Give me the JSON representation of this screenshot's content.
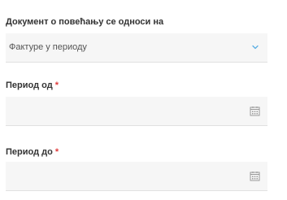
{
  "document_relation": {
    "label": "Документ о повећању се односи на",
    "selected_value": "Фактуре у периоду",
    "icon": "chevron-down-icon"
  },
  "period_from": {
    "label": "Период од",
    "required_marker": "*",
    "value": "",
    "icon": "calendar-icon"
  },
  "period_to": {
    "label": "Период до",
    "required_marker": "*",
    "value": "",
    "icon": "calendar-icon"
  },
  "colors": {
    "field_background": "#f6f6f6",
    "required": "#e03c3c",
    "chevron": "#5aaee3",
    "icon": "#999999"
  }
}
